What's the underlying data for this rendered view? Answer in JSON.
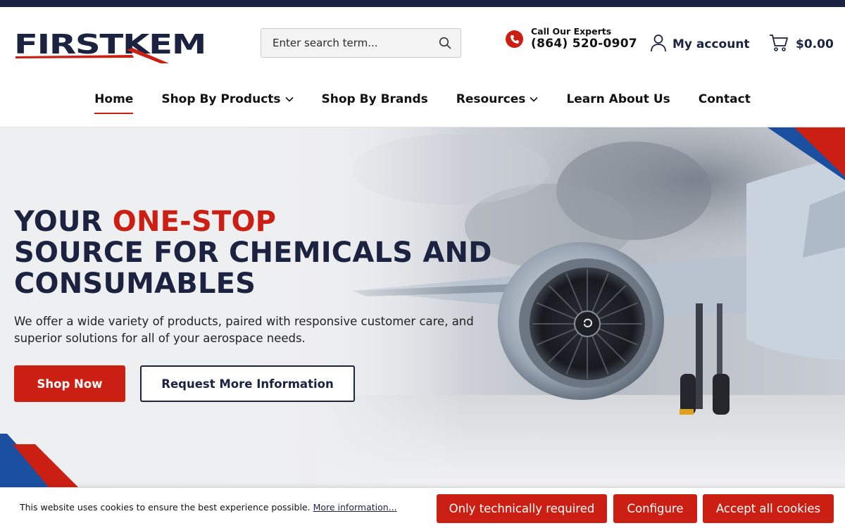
{
  "brand": {
    "name": "FIRSTKEM",
    "accent_red": "#cc1f14",
    "navy": "#1b2340"
  },
  "search": {
    "placeholder": "Enter search term...",
    "icon": "search-icon"
  },
  "contact": {
    "label": "Call Our Experts",
    "phone": "(864) 520-0907",
    "icon": "phone-icon"
  },
  "account": {
    "label": "My account",
    "icon": "user-icon"
  },
  "cart": {
    "total": "$0.00",
    "icon": "cart-icon"
  },
  "nav": {
    "items": [
      {
        "label": "Home",
        "active": true,
        "dropdown": false
      },
      {
        "label": "Shop By Products",
        "active": false,
        "dropdown": true
      },
      {
        "label": "Shop By Brands",
        "active": false,
        "dropdown": false
      },
      {
        "label": "Resources",
        "active": false,
        "dropdown": true
      },
      {
        "label": "Learn About Us",
        "active": false,
        "dropdown": false
      },
      {
        "label": "Contact",
        "active": false,
        "dropdown": false
      }
    ]
  },
  "hero": {
    "headline_part1": "YOUR ",
    "headline_highlight": "ONE-STOP",
    "headline_part2": "SOURCE FOR CHEMICALS AND CONSUMABLES",
    "subtext": "We offer a wide variety of products, paired with responsive customer care, and superior solutions for all of your aerospace needs.",
    "primary_button": "Shop Now",
    "secondary_button": "Request More Information"
  },
  "cookie": {
    "message": "This website uses cookies to ensure the best experience possible.",
    "link": "More information...",
    "btn_required": "Only technically required",
    "btn_configure": "Configure",
    "btn_accept": "Accept all cookies"
  }
}
